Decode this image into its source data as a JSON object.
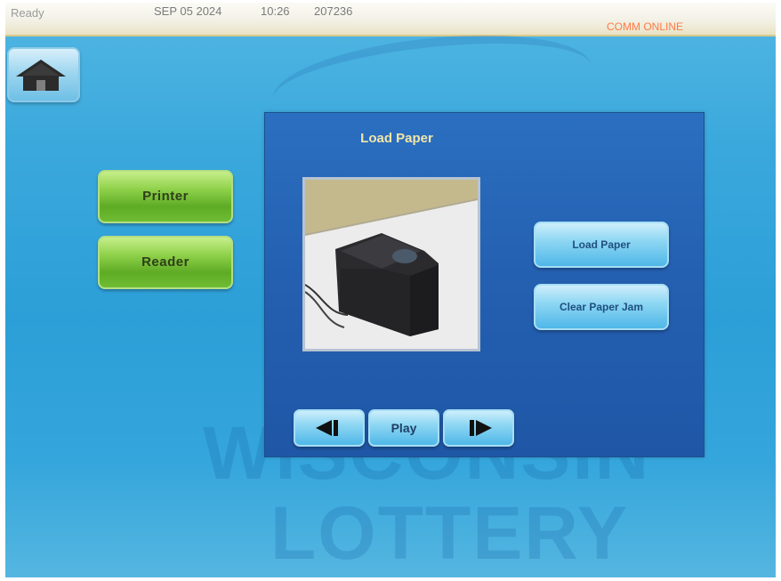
{
  "status": {
    "state": "Ready",
    "date": "SEP 05 2024",
    "time": "10:26",
    "terminal_id": "207236",
    "comm": "COMM ONLINE"
  },
  "home": {
    "icon": "home-icon"
  },
  "side_menu": {
    "printer_label": "Printer",
    "reader_label": "Reader"
  },
  "panel": {
    "title": "Load Paper",
    "load_paper_label": "Load Paper",
    "clear_jam_label": "Clear Paper Jam",
    "play_label": "Play",
    "prev_icon": "previous-icon",
    "next_icon": "next-icon"
  },
  "background": {
    "watermark_line1": "WISCONSIN",
    "watermark_line2": "LOTTERY"
  },
  "colors": {
    "comm_online": "#ff7a4a",
    "panel_blue": "#245fb0",
    "button_green": "#8fd14a",
    "button_blue": "#8fd7f3"
  }
}
